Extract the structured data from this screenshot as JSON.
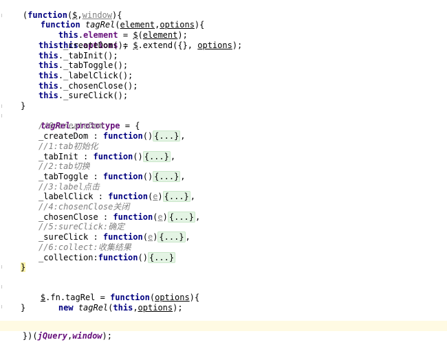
{
  "code": {
    "l1": {
      "a": "(",
      "b": "function",
      "c": "(",
      "d": "$",
      "e": ",",
      "f": "window",
      "g": "){"
    },
    "l2": {
      "a": "function ",
      "b": "tagRel",
      "c": "(",
      "d": "element",
      "e": ",",
      "f": "options",
      "g": "){"
    },
    "l3": {
      "a": "this",
      "b": ".",
      "c": "element",
      "d": " = ",
      "e": "$",
      "f": "(",
      "g": "element",
      "h": ");"
    },
    "l4": {
      "a": "this",
      "b": ".",
      "c": "options",
      "d": " = ",
      "e": "$",
      "f": ".extend({}, ",
      "g": "options",
      "h": ");"
    },
    "l5": {
      "a": "this",
      "b": "._createDom();"
    },
    "l6": {
      "a": "this",
      "b": "._tabInit();"
    },
    "l7": {
      "a": "this",
      "b": "._tabToggle();"
    },
    "l8": {
      "a": "this",
      "b": "._labelClick();"
    },
    "l9": {
      "a": "this",
      "b": "._chosenClose();"
    },
    "l10": {
      "a": "this",
      "b": "._sureClick();"
    },
    "l11": {
      "a": "}"
    },
    "l12": {
      "a": "tagRel",
      "b": ".",
      "c": "prototype",
      "d": " = {"
    },
    "l13": {
      "a": "//0:createDom"
    },
    "l14": {
      "a": "_createDom : ",
      "b": "function",
      "c": "()",
      "d": "{...}",
      "e": ","
    },
    "l15": {
      "a": "//1:tab初始化"
    },
    "l16": {
      "a": "_tabInit : ",
      "b": "function",
      "c": "()",
      "d": "{...}",
      "e": ","
    },
    "l17": {
      "a": "//2:tab切换"
    },
    "l18": {
      "a": "_tabToggle : ",
      "b": "function",
      "c": "()",
      "d": "{...}",
      "e": ","
    },
    "l19": {
      "a": "//3:label点击"
    },
    "l20": {
      "a": "_labelClick : ",
      "b": "function",
      "c": "(",
      "d": "e",
      "e": ")",
      "f": "{...}",
      "g": ","
    },
    "l21": {
      "a": "//4:chosenClose关闭"
    },
    "l22": {
      "a": "_chosenClose : ",
      "b": "function",
      "c": "(",
      "d": "e",
      "e": ")",
      "f": "{...}",
      "g": ","
    },
    "l23": {
      "a": "//5:sureClick:确定"
    },
    "l24": {
      "a": "_sureClick : ",
      "b": "function",
      "c": "(",
      "d": "e",
      "e": ")",
      "f": "{...}",
      "g": ","
    },
    "l25": {
      "a": "//6:collect:收集结果"
    },
    "l26": {
      "a": "_collection:",
      "b": "function",
      "c": "()",
      "d": "{...}"
    },
    "l27": {
      "a": "}"
    },
    "l29": {
      "a": "$",
      "b": ".fn.tagRel = ",
      "c": "function",
      "d": "(",
      "e": "options",
      "f": "){"
    },
    "l30": {
      "a": "new ",
      "b": "tagRel",
      "c": "(",
      "d": "this",
      "e": ",",
      "f": "options",
      "g": ");"
    },
    "l31": {
      "a": "}"
    },
    "l33": {
      "a": "})(",
      "b": "jQuery",
      "c": ",",
      "d": "window",
      "e": ");"
    }
  }
}
